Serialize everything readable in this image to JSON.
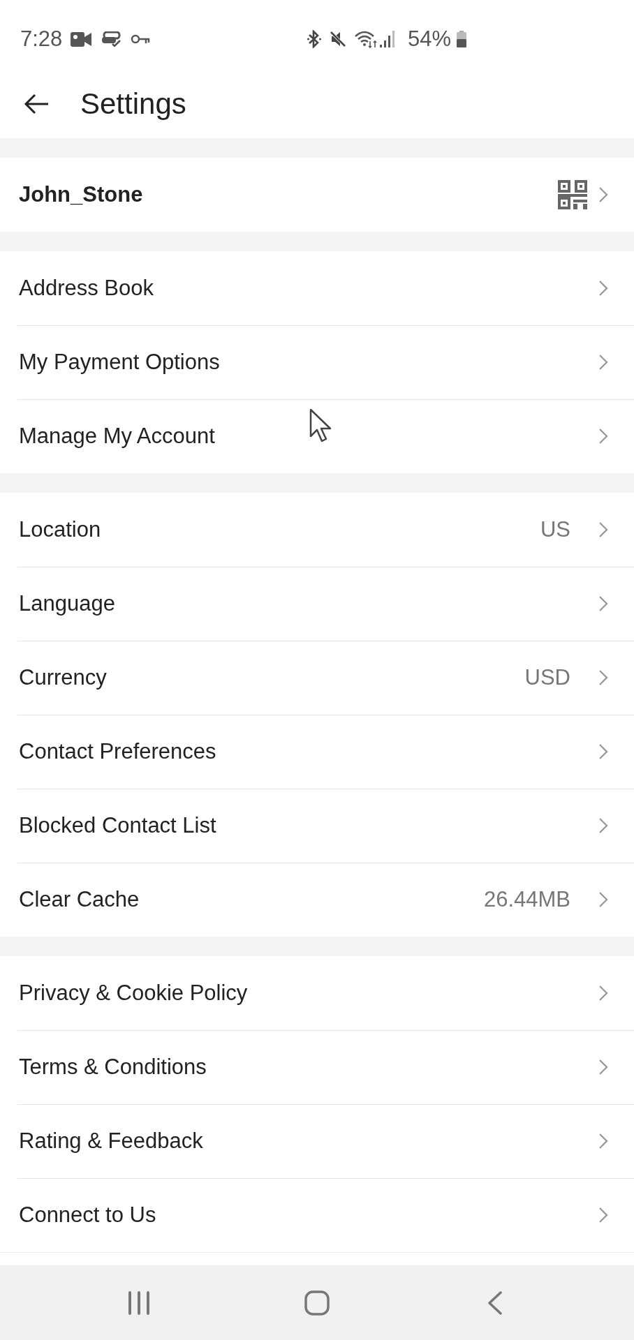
{
  "status_bar": {
    "time": "7:28",
    "battery": "54%"
  },
  "header": {
    "title": "Settings"
  },
  "sections": [
    {
      "items": [
        {
          "kind": "profile",
          "label": "John_Stone"
        }
      ]
    },
    {
      "items": [
        {
          "kind": "link",
          "label": "Address Book"
        },
        {
          "kind": "link",
          "label": "My Payment Options"
        },
        {
          "kind": "link",
          "label": "Manage My Account"
        }
      ]
    },
    {
      "items": [
        {
          "kind": "link",
          "label": "Location",
          "value": "US"
        },
        {
          "kind": "link",
          "label": "Language"
        },
        {
          "kind": "link",
          "label": "Currency",
          "value": "USD"
        },
        {
          "kind": "link",
          "label": "Contact Preferences"
        },
        {
          "kind": "link",
          "label": "Blocked Contact List"
        },
        {
          "kind": "link",
          "label": "Clear Cache",
          "value": "26.44MB"
        }
      ]
    },
    {
      "items": [
        {
          "kind": "link",
          "label": "Privacy & Cookie Policy"
        },
        {
          "kind": "link",
          "label": "Terms & Conditions"
        },
        {
          "kind": "link",
          "label": "Rating & Feedback"
        },
        {
          "kind": "link",
          "label": "Connect to Us"
        }
      ]
    }
  ]
}
